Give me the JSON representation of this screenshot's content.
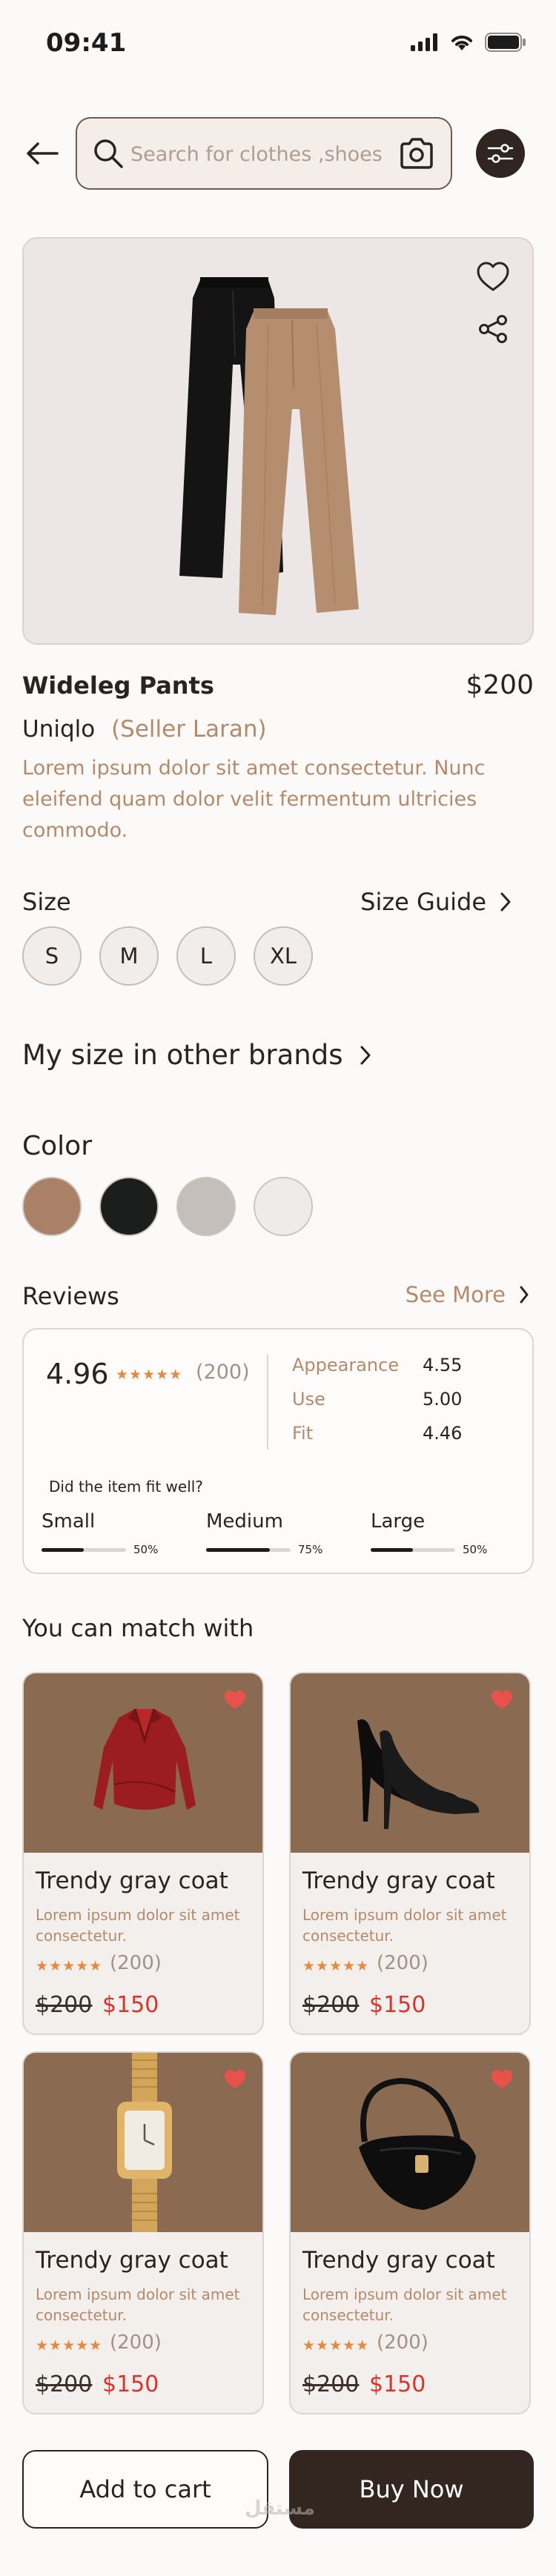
{
  "status_bar": {
    "time": "09:41"
  },
  "search": {
    "placeholder": "Search for clothes ,shoes"
  },
  "product": {
    "name": "Wideleg Pants",
    "price": "$200",
    "brand": "Uniqlo",
    "seller": "(Seller Laran)",
    "description": "Lorem ipsum dolor sit amet consectetur. Nunc eleifend quam dolor velit fermentum ultricies commodo."
  },
  "size": {
    "heading": "Size",
    "guide_label": "Size Guide",
    "options": [
      "S",
      "M",
      "L",
      "XL"
    ]
  },
  "other_brands_label": "My size in other brands",
  "color": {
    "heading": "Color",
    "swatches": [
      "#a98166",
      "#1b1e1c",
      "#c5bfbc",
      "#eeebea"
    ]
  },
  "reviews": {
    "heading": "Reviews",
    "see_more": "See More",
    "rating": "4.96",
    "stars": "★★★★★",
    "count": "(200)",
    "metrics": [
      {
        "label": "Appearance",
        "value": "4.55"
      },
      {
        "label": "Use",
        "value": "5.00"
      },
      {
        "label": "Fit",
        "value": "4.46"
      }
    ],
    "fit_question": "Did the item fit well?",
    "fit": [
      {
        "label": "Small",
        "percent_text": "50%",
        "fraction": 0.5
      },
      {
        "label": "Medium",
        "percent_text": "75%",
        "fraction": 0.75
      },
      {
        "label": "Large",
        "percent_text": "50%",
        "fraction": 0.5
      }
    ]
  },
  "match": {
    "heading": "You can match with",
    "items": [
      {
        "title": "Trendy gray coat",
        "desc": "Lorem ipsum dolor sit amet consectetur.",
        "stars": "★★★★★",
        "count": "(200)",
        "old_price": "$200",
        "new_price": "$150",
        "image": "red-blouse"
      },
      {
        "title": "Trendy gray coat",
        "desc": "Lorem ipsum dolor sit amet consectetur.",
        "stars": "★★★★★",
        "count": "(200)",
        "old_price": "$200",
        "new_price": "$150",
        "image": "black-heels"
      },
      {
        "title": "Trendy gray coat",
        "desc": "Lorem ipsum dolor sit amet consectetur.",
        "stars": "★★★★★",
        "count": "(200)",
        "old_price": "$200",
        "new_price": "$150",
        "image": "gold-watch"
      },
      {
        "title": "Trendy gray coat",
        "desc": "Lorem ipsum dolor sit amet consectetur.",
        "stars": "★★★★★",
        "count": "(200)",
        "old_price": "$200",
        "new_price": "$150",
        "image": "black-handbag"
      }
    ]
  },
  "actions": {
    "add_to_cart": "Add to cart",
    "buy_now": "Buy Now"
  },
  "watermark": "مستقل",
  "colors": {
    "accent": "#b58a6b",
    "dark": "#33251f",
    "sale_red": "#d9342b",
    "star": "#e48a3e",
    "heart": "#e8524a",
    "card_image_bg": "#8a6a50"
  }
}
